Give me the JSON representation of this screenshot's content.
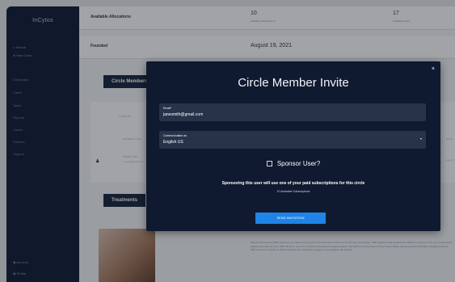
{
  "app": {
    "logo": "InCytos"
  },
  "sidebar": {
    "top_items": [
      {
        "label": "Search"
      },
      {
        "label": "New Case"
      }
    ],
    "items": [
      {
        "label": "Dashboard"
      },
      {
        "label": "Cases"
      },
      {
        "label": "Tasks"
      },
      {
        "label": "Reports"
      },
      {
        "label": "Circles"
      },
      {
        "label": "Patients"
      },
      {
        "label": "Support"
      }
    ],
    "bottom_items": [
      {
        "label": "Account"
      },
      {
        "label": "Profile"
      }
    ]
  },
  "details": {
    "allocations_label": "Available Allocations",
    "stat1_value": "10",
    "stat1_caption": "Available Subscriptions",
    "stat2_value": "17",
    "stat2_caption": "Available Cases",
    "founded_label": "Founded",
    "founded_value": "August 19, 2021"
  },
  "circle_members_tab": "Circle Members",
  "treatment_tab": "Treatments",
  "members_table": {
    "search_placeholder": "Search",
    "member_column": "MEMBER NAME",
    "right_column": "DATE",
    "member_name": "Regan Keel",
    "member_email": "rs.keel@gmail.com",
    "member_date": "Aug 19"
  },
  "background_text": "Platelet rich plasma (PRP) injections are offered by Insync for the treatment of hair loss in both men and women. PRP injections that caused hair follicles to remain in rest, can result in both female and male hair loss. PRP has been used for a variety of clinical and surgical healing. The PRP is a component of blood that contains special proteins that help in healing functions. PRP is used in a variety of clinical settings from orthopedic surgery to encouraging hair growth.",
  "modal": {
    "title": "Circle Member Invite",
    "close_glyph": "×",
    "email_label": "Email*",
    "email_value": "janesmith@gmail.com",
    "communication_label": "Communication as",
    "communication_value": "English US",
    "caret_glyph": "▾",
    "sponsor_label": "Sponsor User?",
    "sponsor_note": "Sponsoring this user will use one of your paid subscriptions for this circle",
    "sponsor_sub": "10 Available Subscriptions",
    "send_label": "SEND INVITATION"
  },
  "colors": {
    "sidebar": "#15203a",
    "modal": "#0f1a30",
    "field": "#263349",
    "accent": "#1f84e6"
  },
  "icons": {
    "search": "search-icon",
    "new_case": "new-case-icon",
    "user": "user-icon",
    "close": "close-icon",
    "caret": "chevron-down-icon"
  }
}
